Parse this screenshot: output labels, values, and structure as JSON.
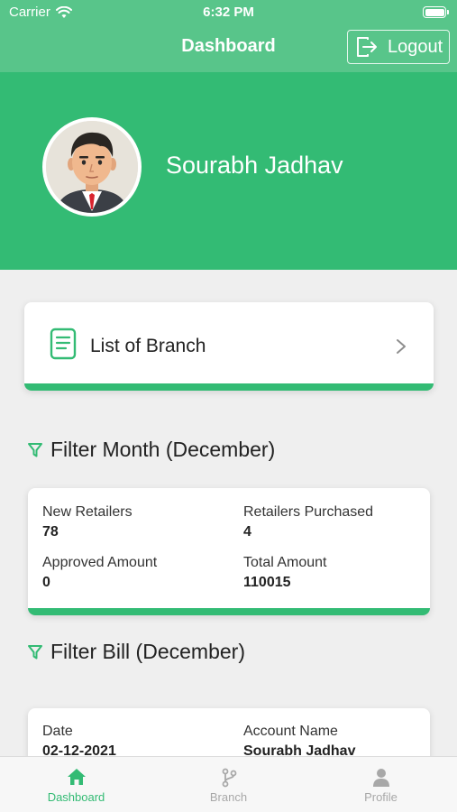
{
  "status_bar": {
    "carrier": "Carrier",
    "time": "6:32 PM"
  },
  "nav": {
    "title": "Dashboard",
    "logout_label": "Logout"
  },
  "profile": {
    "name": "Sourabh Jadhav"
  },
  "branch_card": {
    "label": "List of Branch",
    "icon": "document-icon"
  },
  "filter_month": {
    "title": "Filter Month (December)",
    "stats": [
      {
        "label": "New Retailers",
        "value": "78"
      },
      {
        "label": "Retailers Purchased",
        "value": "4"
      },
      {
        "label": "Approved Amount",
        "value": "0"
      },
      {
        "label": "Total Amount",
        "value": "110015"
      }
    ]
  },
  "filter_bill": {
    "title": "Filter Bill (December)",
    "fields": [
      {
        "label": "Date",
        "value": "02-12-2021"
      },
      {
        "label": "Account Name",
        "value": "Sourabh Jadhav"
      }
    ]
  },
  "tabbar": {
    "tabs": [
      {
        "label": "Dashboard",
        "icon": "home-icon",
        "active": true
      },
      {
        "label": "Branch",
        "icon": "branch-icon",
        "active": false
      },
      {
        "label": "Profile",
        "icon": "person-icon",
        "active": false
      }
    ]
  },
  "colors": {
    "primary": "#33bb74",
    "nav": "#58c58a",
    "background": "#efefef",
    "inactive": "#a8a8a8"
  }
}
